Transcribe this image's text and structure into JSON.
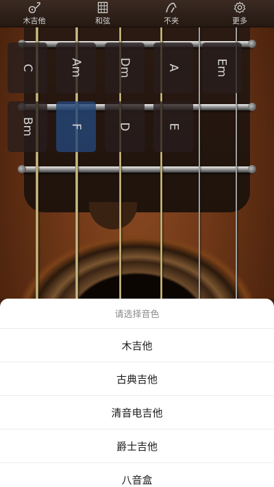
{
  "topbar": {
    "tabs": [
      {
        "label": "木吉他",
        "icon": "guitar-icon"
      },
      {
        "label": "和弦",
        "icon": "chord-chart-icon"
      },
      {
        "label": "不夹",
        "icon": "capo-icon"
      },
      {
        "label": "更多",
        "icon": "gear-icon"
      }
    ]
  },
  "chords": {
    "row1": [
      "C",
      "Am",
      "Dm",
      "A",
      "Em"
    ],
    "row2": [
      "Bm",
      "F",
      "D",
      "E"
    ],
    "selected": "F"
  },
  "sheet": {
    "title": "请选择音色",
    "options": [
      "木吉他",
      "古典吉他",
      "清音电吉他",
      "爵士吉他",
      "八音盒"
    ]
  },
  "colors": {
    "selected_chord": "#244678",
    "wood": "#6e3717"
  }
}
